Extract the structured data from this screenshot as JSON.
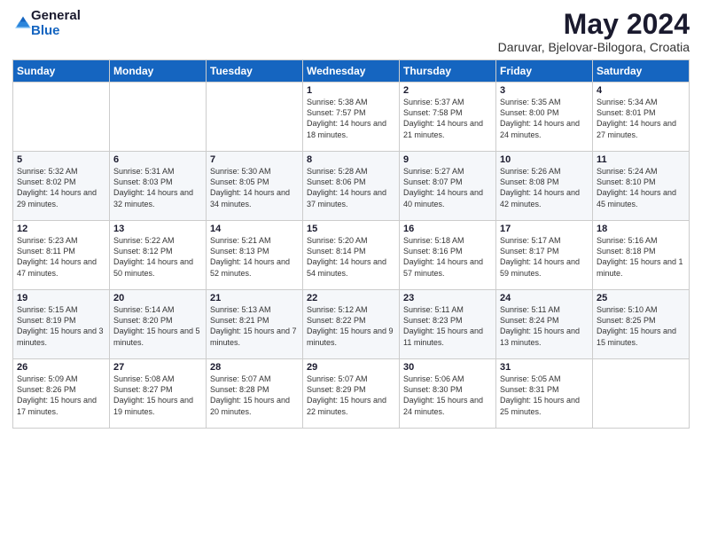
{
  "header": {
    "logo_general": "General",
    "logo_blue": "Blue",
    "title": "May 2024",
    "subtitle": "Daruvar, Bjelovar-Bilogora, Croatia"
  },
  "days_of_week": [
    "Sunday",
    "Monday",
    "Tuesday",
    "Wednesday",
    "Thursday",
    "Friday",
    "Saturday"
  ],
  "weeks": [
    [
      {
        "day": "",
        "sunrise": "",
        "sunset": "",
        "daylight": ""
      },
      {
        "day": "",
        "sunrise": "",
        "sunset": "",
        "daylight": ""
      },
      {
        "day": "",
        "sunrise": "",
        "sunset": "",
        "daylight": ""
      },
      {
        "day": "1",
        "sunrise": "Sunrise: 5:38 AM",
        "sunset": "Sunset: 7:57 PM",
        "daylight": "Daylight: 14 hours and 18 minutes."
      },
      {
        "day": "2",
        "sunrise": "Sunrise: 5:37 AM",
        "sunset": "Sunset: 7:58 PM",
        "daylight": "Daylight: 14 hours and 21 minutes."
      },
      {
        "day": "3",
        "sunrise": "Sunrise: 5:35 AM",
        "sunset": "Sunset: 8:00 PM",
        "daylight": "Daylight: 14 hours and 24 minutes."
      },
      {
        "day": "4",
        "sunrise": "Sunrise: 5:34 AM",
        "sunset": "Sunset: 8:01 PM",
        "daylight": "Daylight: 14 hours and 27 minutes."
      }
    ],
    [
      {
        "day": "5",
        "sunrise": "Sunrise: 5:32 AM",
        "sunset": "Sunset: 8:02 PM",
        "daylight": "Daylight: 14 hours and 29 minutes."
      },
      {
        "day": "6",
        "sunrise": "Sunrise: 5:31 AM",
        "sunset": "Sunset: 8:03 PM",
        "daylight": "Daylight: 14 hours and 32 minutes."
      },
      {
        "day": "7",
        "sunrise": "Sunrise: 5:30 AM",
        "sunset": "Sunset: 8:05 PM",
        "daylight": "Daylight: 14 hours and 34 minutes."
      },
      {
        "day": "8",
        "sunrise": "Sunrise: 5:28 AM",
        "sunset": "Sunset: 8:06 PM",
        "daylight": "Daylight: 14 hours and 37 minutes."
      },
      {
        "day": "9",
        "sunrise": "Sunrise: 5:27 AM",
        "sunset": "Sunset: 8:07 PM",
        "daylight": "Daylight: 14 hours and 40 minutes."
      },
      {
        "day": "10",
        "sunrise": "Sunrise: 5:26 AM",
        "sunset": "Sunset: 8:08 PM",
        "daylight": "Daylight: 14 hours and 42 minutes."
      },
      {
        "day": "11",
        "sunrise": "Sunrise: 5:24 AM",
        "sunset": "Sunset: 8:10 PM",
        "daylight": "Daylight: 14 hours and 45 minutes."
      }
    ],
    [
      {
        "day": "12",
        "sunrise": "Sunrise: 5:23 AM",
        "sunset": "Sunset: 8:11 PM",
        "daylight": "Daylight: 14 hours and 47 minutes."
      },
      {
        "day": "13",
        "sunrise": "Sunrise: 5:22 AM",
        "sunset": "Sunset: 8:12 PM",
        "daylight": "Daylight: 14 hours and 50 minutes."
      },
      {
        "day": "14",
        "sunrise": "Sunrise: 5:21 AM",
        "sunset": "Sunset: 8:13 PM",
        "daylight": "Daylight: 14 hours and 52 minutes."
      },
      {
        "day": "15",
        "sunrise": "Sunrise: 5:20 AM",
        "sunset": "Sunset: 8:14 PM",
        "daylight": "Daylight: 14 hours and 54 minutes."
      },
      {
        "day": "16",
        "sunrise": "Sunrise: 5:18 AM",
        "sunset": "Sunset: 8:16 PM",
        "daylight": "Daylight: 14 hours and 57 minutes."
      },
      {
        "day": "17",
        "sunrise": "Sunrise: 5:17 AM",
        "sunset": "Sunset: 8:17 PM",
        "daylight": "Daylight: 14 hours and 59 minutes."
      },
      {
        "day": "18",
        "sunrise": "Sunrise: 5:16 AM",
        "sunset": "Sunset: 8:18 PM",
        "daylight": "Daylight: 15 hours and 1 minute."
      }
    ],
    [
      {
        "day": "19",
        "sunrise": "Sunrise: 5:15 AM",
        "sunset": "Sunset: 8:19 PM",
        "daylight": "Daylight: 15 hours and 3 minutes."
      },
      {
        "day": "20",
        "sunrise": "Sunrise: 5:14 AM",
        "sunset": "Sunset: 8:20 PM",
        "daylight": "Daylight: 15 hours and 5 minutes."
      },
      {
        "day": "21",
        "sunrise": "Sunrise: 5:13 AM",
        "sunset": "Sunset: 8:21 PM",
        "daylight": "Daylight: 15 hours and 7 minutes."
      },
      {
        "day": "22",
        "sunrise": "Sunrise: 5:12 AM",
        "sunset": "Sunset: 8:22 PM",
        "daylight": "Daylight: 15 hours and 9 minutes."
      },
      {
        "day": "23",
        "sunrise": "Sunrise: 5:11 AM",
        "sunset": "Sunset: 8:23 PM",
        "daylight": "Daylight: 15 hours and 11 minutes."
      },
      {
        "day": "24",
        "sunrise": "Sunrise: 5:11 AM",
        "sunset": "Sunset: 8:24 PM",
        "daylight": "Daylight: 15 hours and 13 minutes."
      },
      {
        "day": "25",
        "sunrise": "Sunrise: 5:10 AM",
        "sunset": "Sunset: 8:25 PM",
        "daylight": "Daylight: 15 hours and 15 minutes."
      }
    ],
    [
      {
        "day": "26",
        "sunrise": "Sunrise: 5:09 AM",
        "sunset": "Sunset: 8:26 PM",
        "daylight": "Daylight: 15 hours and 17 minutes."
      },
      {
        "day": "27",
        "sunrise": "Sunrise: 5:08 AM",
        "sunset": "Sunset: 8:27 PM",
        "daylight": "Daylight: 15 hours and 19 minutes."
      },
      {
        "day": "28",
        "sunrise": "Sunrise: 5:07 AM",
        "sunset": "Sunset: 8:28 PM",
        "daylight": "Daylight: 15 hours and 20 minutes."
      },
      {
        "day": "29",
        "sunrise": "Sunrise: 5:07 AM",
        "sunset": "Sunset: 8:29 PM",
        "daylight": "Daylight: 15 hours and 22 minutes."
      },
      {
        "day": "30",
        "sunrise": "Sunrise: 5:06 AM",
        "sunset": "Sunset: 8:30 PM",
        "daylight": "Daylight: 15 hours and 24 minutes."
      },
      {
        "day": "31",
        "sunrise": "Sunrise: 5:05 AM",
        "sunset": "Sunset: 8:31 PM",
        "daylight": "Daylight: 15 hours and 25 minutes."
      },
      {
        "day": "",
        "sunrise": "",
        "sunset": "",
        "daylight": ""
      }
    ]
  ]
}
